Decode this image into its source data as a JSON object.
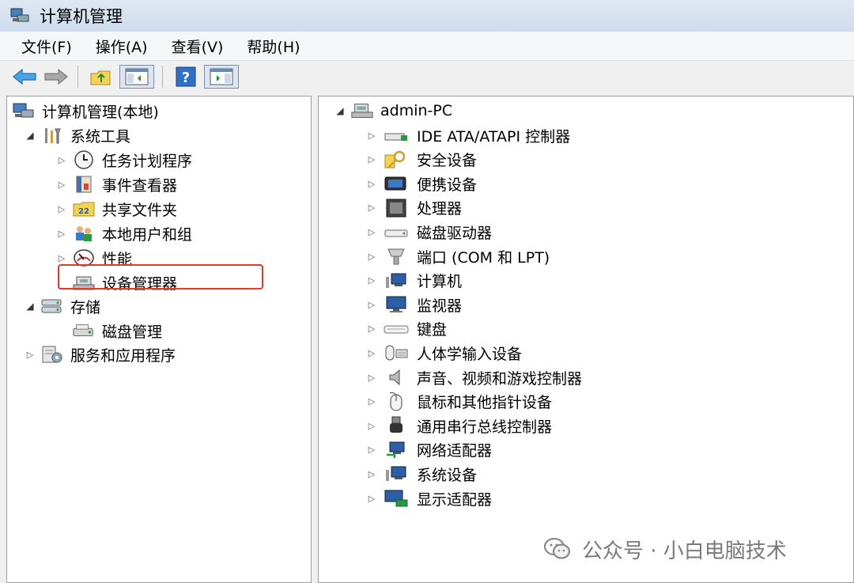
{
  "window": {
    "title": "计算机管理"
  },
  "menu": [
    "文件(F)",
    "操作(A)",
    "查看(V)",
    "帮助(H)"
  ],
  "toolbar": [
    {
      "icon": "back-arrow-icon"
    },
    {
      "icon": "forward-arrow-icon"
    },
    {
      "icon": "up-folder-icon"
    },
    {
      "icon": "show-hide-tree-icon"
    },
    {
      "icon": "help-icon"
    },
    {
      "icon": "action-pane-icon"
    }
  ],
  "left_tree": {
    "root": "计算机管理(本地)",
    "system_tools": "系统工具",
    "items": [
      "任务计划程序",
      "事件查看器",
      "共享文件夹",
      "本地用户和组",
      "性能",
      "设备管理器"
    ],
    "storage": "存储",
    "disk_mgmt": "磁盘管理",
    "services": "服务和应用程序"
  },
  "right_tree": {
    "root": "admin-PC",
    "items": [
      "IDE ATA/ATAPI 控制器",
      "安全设备",
      "便携设备",
      "处理器",
      "磁盘驱动器",
      "端口 (COM 和 LPT)",
      "计算机",
      "监视器",
      "键盘",
      "人体学输入设备",
      "声音、视频和游戏控制器",
      "鼠标和其他指针设备",
      "通用串行总线控制器",
      "网络适配器",
      "系统设备",
      "显示适配器"
    ]
  },
  "watermark": "公众号 · 小白电脑技术"
}
